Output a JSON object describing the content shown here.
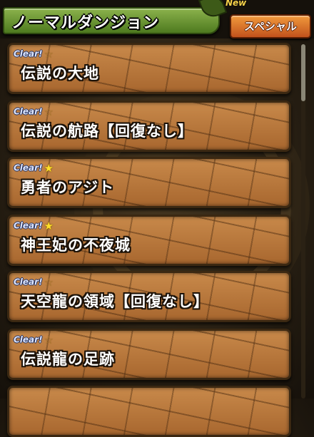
{
  "header": {
    "title": "ノーマルダンジョン",
    "new_label": "New",
    "special_button": "スペシャル"
  },
  "clear_text": "Clear!",
  "dungeons": [
    {
      "name": "伝説の大地",
      "star": "outline"
    },
    {
      "name": "伝説の航路【回復なし】",
      "star": "outline"
    },
    {
      "name": "勇者のアジト",
      "star": "gold"
    },
    {
      "name": "神王妃の不夜城",
      "star": "gold"
    },
    {
      "name": "天空龍の領域【回復なし】",
      "star": "outline"
    },
    {
      "name": "伝説龍の足跡",
      "star": "outline"
    }
  ],
  "colors": {
    "title_green": "#6a9a2e",
    "special_orange": "#e07a2a",
    "panel_brown": "#b4763a",
    "star_gold": "#ffe02a"
  }
}
